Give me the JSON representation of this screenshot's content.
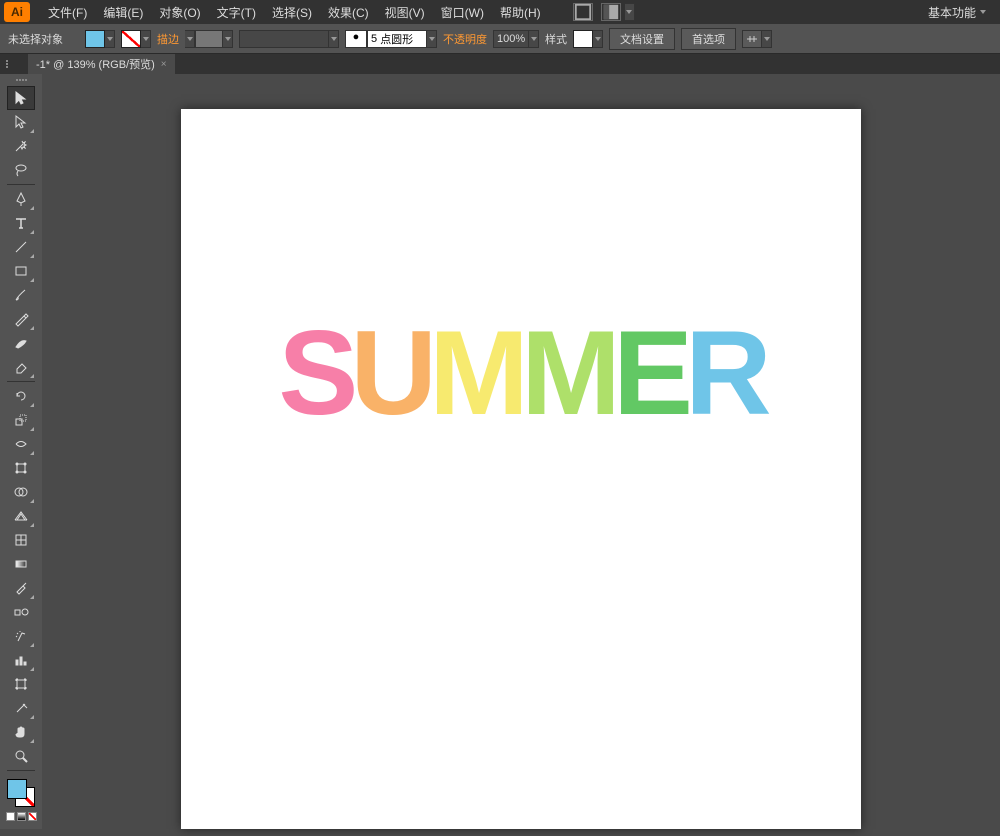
{
  "app": {
    "logo_text": "Ai"
  },
  "menu": {
    "file": "文件(F)",
    "edit": "编辑(E)",
    "object": "对象(O)",
    "type": "文字(T)",
    "select": "选择(S)",
    "effect": "效果(C)",
    "view": "视图(V)",
    "window": "窗口(W)",
    "help": "帮助(H)",
    "workspace": "基本功能"
  },
  "control": {
    "no_selection": "未选择对象",
    "stroke_label": "描边",
    "stroke_weight": "5",
    "stroke_profile": "点圆形",
    "opacity_label": "不透明度",
    "opacity_value": "100%",
    "style_label": "样式",
    "doc_setup": "文档设置",
    "prefs": "首选项"
  },
  "tab": {
    "title": "-1* @ 139% (RGB/预览)",
    "close": "×"
  },
  "canvas": {
    "text": {
      "s": "S",
      "u": "U",
      "m1": "M",
      "m2": "M",
      "e": "E",
      "r": "R"
    }
  },
  "tools": [
    "selection",
    "direct-selection",
    "magic-wand",
    "lasso",
    "pen",
    "type",
    "line",
    "rectangle",
    "paintbrush",
    "pencil",
    "blob-brush",
    "eraser",
    "rotate",
    "scale",
    "width",
    "free-transform",
    "shape-builder",
    "perspective-grid",
    "mesh",
    "gradient",
    "eyedropper",
    "blend",
    "symbol-sprayer",
    "column-graph",
    "artboard",
    "slice",
    "hand",
    "zoom"
  ]
}
